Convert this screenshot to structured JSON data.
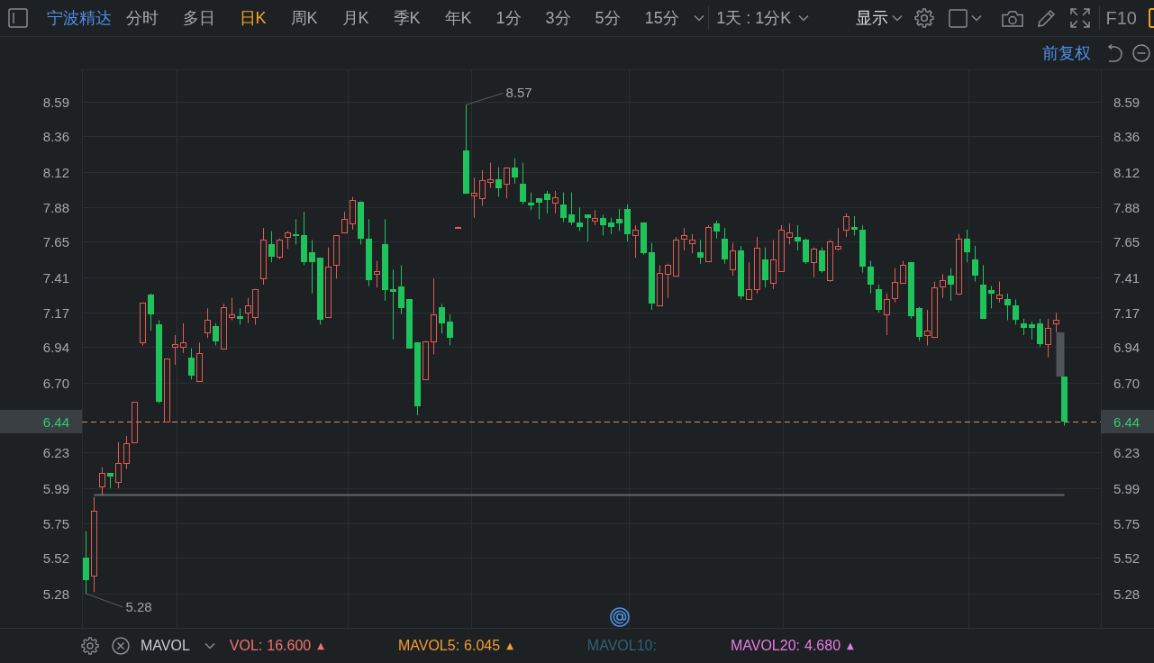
{
  "toolbar": {
    "stock_name": "宁波精达",
    "periods": [
      {
        "label": "分时",
        "selected": false
      },
      {
        "label": "多日",
        "selected": false
      },
      {
        "label": "日K",
        "selected": true
      },
      {
        "label": "周K",
        "selected": false
      },
      {
        "label": "月K",
        "selected": false
      },
      {
        "label": "季K",
        "selected": false
      },
      {
        "label": "年K",
        "selected": false
      },
      {
        "label": "1分",
        "selected": false
      },
      {
        "label": "3分",
        "selected": false
      },
      {
        "label": "5分",
        "selected": false
      },
      {
        "label": "15分",
        "selected": false
      }
    ],
    "range_select": "1天 : 1分K",
    "display_menu": "显示",
    "f10_button": "F10"
  },
  "chart_header": {
    "adjust_mode": "前复权"
  },
  "price_chart": {
    "right_axis": [
      "8.59",
      "8.36",
      "8.12",
      "7.88",
      "7.65",
      "7.41",
      "7.17",
      "6.94",
      "6.70",
      "6.23",
      "5.99",
      "5.75",
      "5.52",
      "5.28"
    ],
    "right_price_tag": "6.44",
    "high_label": "8.57",
    "low_label": "5.28",
    "chart_data": {
      "type": "candlestick",
      "grid": true,
      "ylim": [
        5.28,
        8.59
      ],
      "yticks": [
        8.59,
        8.36,
        8.12,
        7.88,
        7.65,
        7.41,
        7.17,
        6.94,
        {
          "value": 6.7,
          "label": "6.70"
        },
        6.23,
        5.99,
        5.75,
        5.52,
        5.28
      ],
      "ref_lines": [
        {
          "axis": "y",
          "value": 6.44,
          "label": "6.44"
        },
        {
          "axis": "y",
          "value": 5.946
        }
      ],
      "categories": [
        null,
        null,
        null,
        null,
        null,
        null,
        null,
        null,
        null,
        null,
        null,
        null,
        null,
        null,
        null,
        null,
        null,
        null,
        null,
        null,
        null,
        null,
        null,
        null,
        null,
        null,
        null,
        null,
        null,
        null,
        null,
        null,
        null,
        null,
        null,
        null,
        null,
        null,
        null,
        null,
        null,
        null,
        null,
        null,
        null,
        null,
        null,
        null,
        null,
        null,
        null,
        null,
        null,
        null,
        null,
        null,
        null,
        null,
        null,
        null,
        null,
        null,
        null,
        null,
        null,
        null,
        null,
        null,
        null,
        null,
        null,
        null,
        null,
        null,
        null,
        null,
        null,
        null,
        null,
        null,
        null,
        null,
        null,
        null,
        null,
        null,
        null,
        null,
        null,
        null,
        null,
        null,
        null,
        null,
        null,
        null,
        null,
        null,
        null,
        null,
        null,
        null,
        null,
        null,
        null,
        null,
        null,
        null,
        null,
        null,
        null,
        null,
        null,
        null,
        null,
        null,
        null,
        null,
        null,
        null,
        null,
        null,
        null,
        null,
        null,
        null
      ],
      "ohlc": [
        [
          5.52,
          5.7,
          5.28,
          5.37
        ],
        [
          5.4,
          5.93,
          5.29,
          5.84
        ],
        [
          6.0,
          6.13,
          5.94,
          6.09
        ],
        [
          6.09,
          6.09,
          5.99,
          6.07
        ],
        [
          6.03,
          6.3,
          5.99,
          6.16
        ],
        [
          6.16,
          6.34,
          6.12,
          6.29
        ],
        [
          6.3,
          6.57,
          6.3,
          6.57
        ],
        [
          6.97,
          7.24,
          6.95,
          7.24
        ],
        [
          7.29,
          7.3,
          7.05,
          7.16
        ],
        [
          7.09,
          7.12,
          6.56,
          6.57
        ],
        [
          6.44,
          6.86,
          6.44,
          6.86
        ],
        [
          6.94,
          7.02,
          6.82,
          6.96
        ],
        [
          6.94,
          7.1,
          6.9,
          6.97
        ],
        [
          6.87,
          6.93,
          6.72,
          6.75
        ],
        [
          6.71,
          6.97,
          6.71,
          6.9
        ],
        [
          7.04,
          7.2,
          7.0,
          7.12
        ],
        [
          7.08,
          7.1,
          6.95,
          6.98
        ],
        [
          6.93,
          7.23,
          6.93,
          7.21
        ],
        [
          7.14,
          7.27,
          7.12,
          7.16
        ],
        [
          7.15,
          7.2,
          7.09,
          7.13
        ],
        [
          7.17,
          7.27,
          7.1,
          7.22
        ],
        [
          7.14,
          7.33,
          7.09,
          7.33
        ],
        [
          7.4,
          7.74,
          7.36,
          7.66
        ],
        [
          7.63,
          7.72,
          7.51,
          7.55
        ],
        [
          7.55,
          7.67,
          7.53,
          7.66
        ],
        [
          7.68,
          7.72,
          7.6,
          7.71
        ],
        [
          7.7,
          7.8,
          7.63,
          7.69
        ],
        [
          7.69,
          7.85,
          7.49,
          7.51
        ],
        [
          7.58,
          7.66,
          7.3,
          7.51
        ],
        [
          7.54,
          7.54,
          7.09,
          7.12
        ],
        [
          7.14,
          7.61,
          7.14,
          7.48
        ],
        [
          7.49,
          7.69,
          7.4,
          7.69
        ],
        [
          7.71,
          7.85,
          7.71,
          7.8
        ],
        [
          7.77,
          7.95,
          7.73,
          7.93
        ],
        [
          7.92,
          7.92,
          7.63,
          7.67
        ],
        [
          7.67,
          7.8,
          7.35,
          7.39
        ],
        [
          7.43,
          7.52,
          7.34,
          7.45
        ],
        [
          7.63,
          7.8,
          7.25,
          7.32
        ],
        [
          7.33,
          7.46,
          6.99,
          7.31
        ],
        [
          7.35,
          7.49,
          7.16,
          7.2
        ],
        [
          7.26,
          7.26,
          6.93,
          6.93
        ],
        [
          6.97,
          6.97,
          6.48,
          6.54
        ],
        [
          6.72,
          6.98,
          6.72,
          6.98
        ],
        [
          6.98,
          7.4,
          6.89,
          7.16
        ],
        [
          7.21,
          7.23,
          7.03,
          7.1
        ],
        [
          7.11,
          7.16,
          6.95,
          7.0
        ],
        [
          7.75,
          7.75,
          7.75,
          7.75
        ],
        [
          8.26,
          8.57,
          7.97,
          7.97
        ],
        [
          7.96,
          8.08,
          7.81,
          7.98
        ],
        [
          7.94,
          8.13,
          7.89,
          8.06
        ],
        [
          8.05,
          8.18,
          8.01,
          8.07
        ],
        [
          8.07,
          8.15,
          7.95,
          8.01
        ],
        [
          8.04,
          8.15,
          7.94,
          8.15
        ],
        [
          8.15,
          8.21,
          8.04,
          8.08
        ],
        [
          8.04,
          8.18,
          7.9,
          7.92
        ],
        [
          7.91,
          7.98,
          7.86,
          7.89
        ],
        [
          7.94,
          7.94,
          7.8,
          7.91
        ],
        [
          7.97,
          7.99,
          7.84,
          7.93
        ],
        [
          7.91,
          7.99,
          7.84,
          7.95
        ],
        [
          7.9,
          7.98,
          7.78,
          7.81
        ],
        [
          7.83,
          7.98,
          7.76,
          7.78
        ],
        [
          7.78,
          7.88,
          7.72,
          7.75
        ],
        [
          7.83,
          7.83,
          7.65,
          7.81
        ],
        [
          7.79,
          7.86,
          7.76,
          7.81
        ],
        [
          7.81,
          7.83,
          7.69,
          7.76
        ],
        [
          7.78,
          7.81,
          7.7,
          7.75
        ],
        [
          7.8,
          7.87,
          7.72,
          7.77
        ],
        [
          7.87,
          7.9,
          7.65,
          7.7
        ],
        [
          7.69,
          7.76,
          7.54,
          7.73
        ],
        [
          7.78,
          7.78,
          7.56,
          7.57
        ],
        [
          7.58,
          7.64,
          7.19,
          7.23
        ],
        [
          7.22,
          7.49,
          7.22,
          7.44
        ],
        [
          7.43,
          7.5,
          7.27,
          7.49
        ],
        [
          7.42,
          7.68,
          7.42,
          7.66
        ],
        [
          7.67,
          7.74,
          7.59,
          7.69
        ],
        [
          7.64,
          7.7,
          7.57,
          7.66
        ],
        [
          7.58,
          7.66,
          7.5,
          7.54
        ],
        [
          7.52,
          7.76,
          7.52,
          7.75
        ],
        [
          7.77,
          7.79,
          7.67,
          7.72
        ],
        [
          7.67,
          7.74,
          7.5,
          7.53
        ],
        [
          7.46,
          7.64,
          7.42,
          7.59
        ],
        [
          7.59,
          7.62,
          7.26,
          7.28
        ],
        [
          7.26,
          7.51,
          7.26,
          7.33
        ],
        [
          7.33,
          7.68,
          7.3,
          7.61
        ],
        [
          7.53,
          7.61,
          7.34,
          7.39
        ],
        [
          7.37,
          7.66,
          7.33,
          7.53
        ],
        [
          7.45,
          7.76,
          7.45,
          7.73
        ],
        [
          7.68,
          7.77,
          7.63,
          7.71
        ],
        [
          7.68,
          7.76,
          7.59,
          7.65
        ],
        [
          7.66,
          7.67,
          7.5,
          7.51
        ],
        [
          7.51,
          7.61,
          7.41,
          7.6
        ],
        [
          7.59,
          7.61,
          7.44,
          7.45
        ],
        [
          7.39,
          7.66,
          7.38,
          7.65
        ],
        [
          7.6,
          7.74,
          7.59,
          7.62
        ],
        [
          7.73,
          7.84,
          7.68,
          7.82
        ],
        [
          7.75,
          7.82,
          7.69,
          7.73
        ],
        [
          7.73,
          7.76,
          7.44,
          7.48
        ],
        [
          7.48,
          7.52,
          7.3,
          7.36
        ],
        [
          7.33,
          7.36,
          7.17,
          7.19
        ],
        [
          7.16,
          7.3,
          7.02,
          7.26
        ],
        [
          7.27,
          7.47,
          7.24,
          7.38
        ],
        [
          7.37,
          7.52,
          7.37,
          7.49
        ],
        [
          7.51,
          7.51,
          7.13,
          7.15
        ],
        [
          7.2,
          7.21,
          6.98,
          7.01
        ],
        [
          7.02,
          7.19,
          6.95,
          7.05
        ],
        [
          7.01,
          7.38,
          7.01,
          7.34
        ],
        [
          7.35,
          7.43,
          7.27,
          7.39
        ],
        [
          7.42,
          7.47,
          7.25,
          7.36
        ],
        [
          7.3,
          7.7,
          7.29,
          7.67
        ],
        [
          7.67,
          7.73,
          7.51,
          7.58
        ],
        [
          7.53,
          7.62,
          7.38,
          7.42
        ],
        [
          7.36,
          7.49,
          7.13,
          7.13
        ],
        [
          7.32,
          7.35,
          7.2,
          7.3
        ],
        [
          7.27,
          7.38,
          7.24,
          7.29
        ],
        [
          7.26,
          7.3,
          7.12,
          7.22
        ],
        [
          7.22,
          7.26,
          7.09,
          7.12
        ],
        [
          7.1,
          7.13,
          7.02,
          7.07
        ],
        [
          7.09,
          7.11,
          6.99,
          7.07
        ],
        [
          7.1,
          7.13,
          6.94,
          6.96
        ],
        [
          6.96,
          7.13,
          6.87,
          7.07
        ],
        [
          7.1,
          7.17,
          7.04,
          7.12
        ],
        [
          6.74,
          6.74,
          6.41,
          6.44
        ],
        null,
        null,
        null,
        null
      ]
    }
  },
  "indicator_bar": {
    "name": "MAVOL",
    "items": [
      {
        "label": "VOL:",
        "value": "16.600",
        "color": "#f0736b",
        "arrow": "▲"
      },
      {
        "label": "MAVOL5:",
        "value": "6.045",
        "color": "#f39c33",
        "arrow": "▲"
      },
      {
        "label": "MAVOL10:",
        "color": "#2f6175"
      },
      {
        "label": "MAVOL20:",
        "value": "4.680",
        "color": "#e67be4",
        "arrow": "▲"
      }
    ]
  }
}
